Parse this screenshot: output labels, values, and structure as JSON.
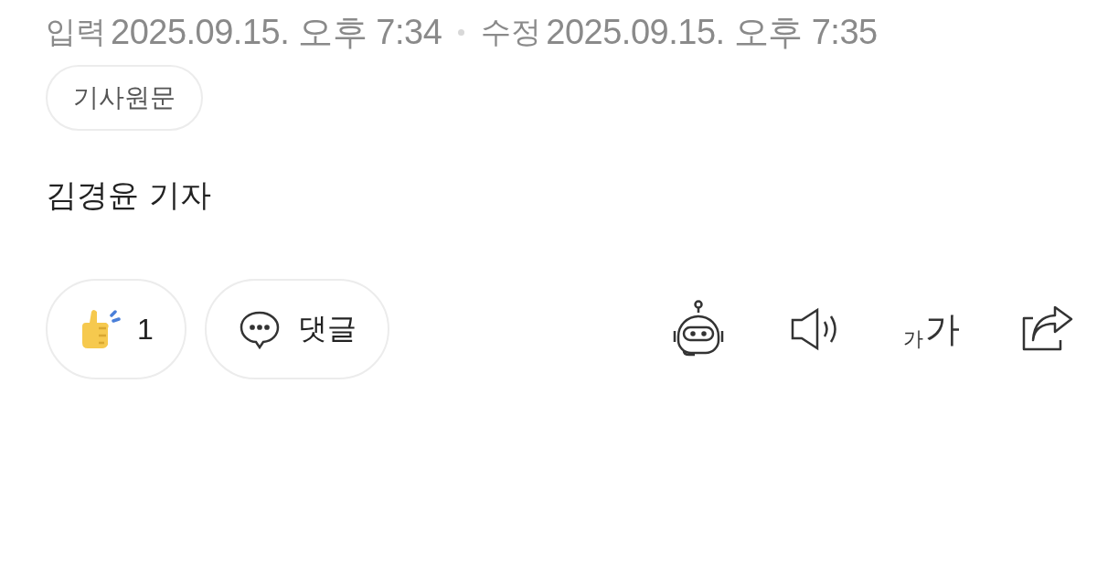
{
  "meta": {
    "input_label": "입력",
    "input_time": "2025.09.15. 오후 7:34",
    "edit_label": "수정",
    "edit_time": "2025.09.15. 오후 7:35"
  },
  "source_button": "기사원문",
  "reporter": "김경윤 기자",
  "actions": {
    "like_count": "1",
    "comment_label": "댓글",
    "font_size_small": "가",
    "font_size_large": "가"
  }
}
